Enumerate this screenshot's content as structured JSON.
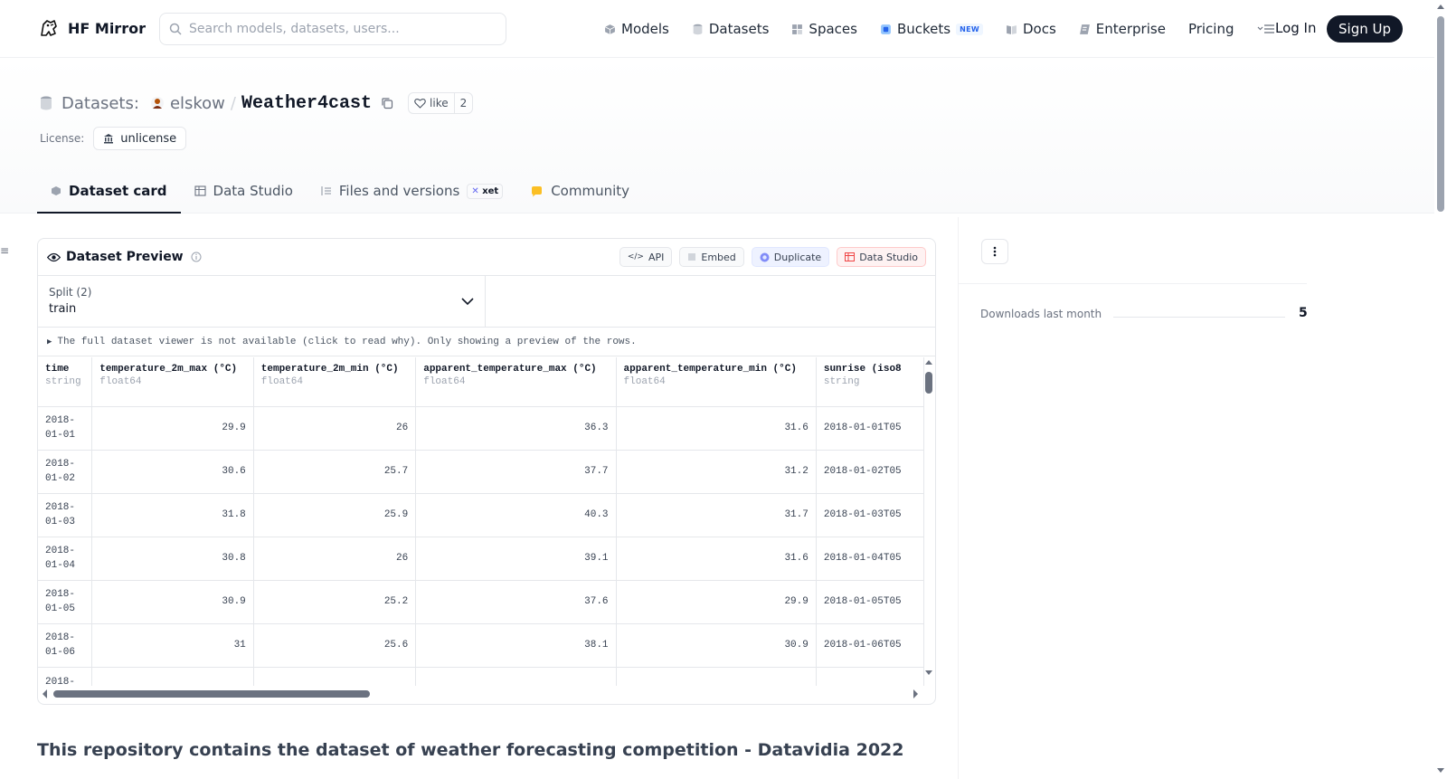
{
  "header": {
    "logo_text": "HF Mirror",
    "search_placeholder": "Search models, datasets, users...",
    "nav": [
      {
        "label": "Models",
        "icon": "models-icon"
      },
      {
        "label": "Datasets",
        "icon": "datasets-icon"
      },
      {
        "label": "Spaces",
        "icon": "spaces-icon"
      },
      {
        "label": "Buckets",
        "icon": "buckets-icon",
        "badge": "NEW"
      },
      {
        "label": "Docs",
        "icon": "docs-icon"
      },
      {
        "label": "Enterprise",
        "icon": "enterprise-icon"
      },
      {
        "label": "Pricing"
      }
    ],
    "login": "Log In",
    "signup": "Sign Up"
  },
  "repo": {
    "type_label": "Datasets:",
    "author": "elskow",
    "slash": "/",
    "name": "Weather4cast",
    "like_label": "like",
    "like_count": "2",
    "license_label": "License:",
    "license_value": "unlicense"
  },
  "tabs": [
    {
      "label": "Dataset card",
      "active": true
    },
    {
      "label": "Data Studio"
    },
    {
      "label": "Files and versions",
      "badge": "xet"
    },
    {
      "label": "Community"
    }
  ],
  "preview": {
    "title": "Dataset Preview",
    "actions": {
      "api": "API",
      "embed": "Embed",
      "duplicate": "Duplicate",
      "data_studio": "Data Studio"
    },
    "split_label": "Split (2)",
    "split_value": "train",
    "notice": "The full dataset viewer is not available (click to read why). Only showing a preview of the rows.",
    "columns": [
      {
        "name": "time",
        "dtype": "string"
      },
      {
        "name": "temperature_2m_max (°C)",
        "dtype": "float64"
      },
      {
        "name": "temperature_2m_min (°C)",
        "dtype": "float64"
      },
      {
        "name": "apparent_temperature_max (°C)",
        "dtype": "float64"
      },
      {
        "name": "apparent_temperature_min (°C)",
        "dtype": "float64"
      },
      {
        "name": "sunrise (iso8",
        "dtype": "string"
      }
    ],
    "rows": [
      [
        "2018-01-01",
        "29.9",
        "26",
        "36.3",
        "31.6",
        "2018-01-01T05"
      ],
      [
        "2018-01-02",
        "30.6",
        "25.7",
        "37.7",
        "31.2",
        "2018-01-02T05"
      ],
      [
        "2018-01-03",
        "31.8",
        "25.9",
        "40.3",
        "31.7",
        "2018-01-03T05"
      ],
      [
        "2018-01-04",
        "30.8",
        "26",
        "39.1",
        "31.6",
        "2018-01-04T05"
      ],
      [
        "2018-01-05",
        "30.9",
        "25.2",
        "37.6",
        "29.9",
        "2018-01-05T05"
      ],
      [
        "2018-01-06",
        "31",
        "25.6",
        "38.1",
        "30.9",
        "2018-01-06T05"
      ],
      [
        "2018-",
        "",
        "",
        "",
        "",
        ""
      ]
    ]
  },
  "description": "This repository contains the dataset of weather forecasting competition - Datavidia 2022",
  "sidebar": {
    "downloads_label": "Downloads last month",
    "downloads_value": "5"
  }
}
